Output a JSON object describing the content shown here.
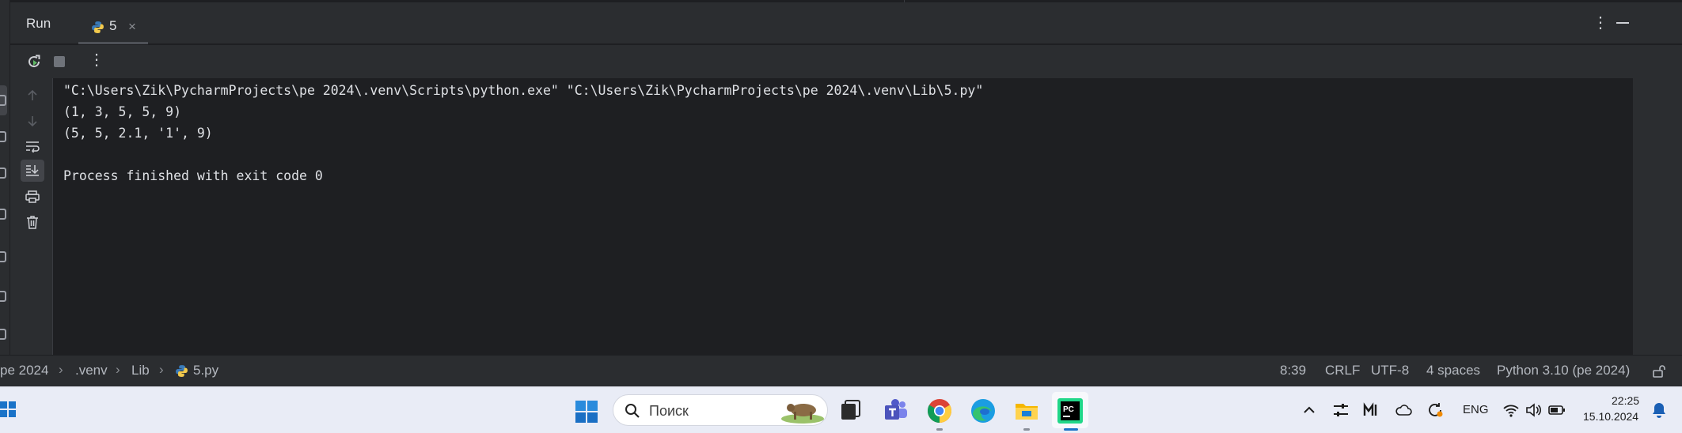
{
  "run_panel": {
    "title": "Run",
    "tab_label": "5",
    "tab_close": "×"
  },
  "console": {
    "lines": [
      "\"C:\\Users\\Zik\\PycharmProjects\\pe 2024\\.venv\\Scripts\\python.exe\" \"C:\\Users\\Zik\\PycharmProjects\\pe 2024\\.venv\\Lib\\5.py\"",
      "(1, 3, 5, 5, 9)",
      "(5, 5, 2.1, '1', 9)",
      "",
      "Process finished with exit code 0"
    ]
  },
  "breadcrumbs": [
    "pe 2024",
    ".venv",
    "Lib",
    "5.py"
  ],
  "status": {
    "position": "8:39",
    "line_separator": "CRLF",
    "encoding": "UTF-8",
    "indent": "4 spaces",
    "interpreter": "Python 3.10 (pe 2024)"
  },
  "taskbar": {
    "search_placeholder": "Поиск",
    "language": "ENG",
    "time": "22:25",
    "date": "15.10.2024"
  },
  "colors": {
    "panel_bg": "#2b2d30",
    "console_bg": "#1e1f22",
    "text": "#dfe1e5",
    "taskbar_bg": "#e9ecf6",
    "pycharm_accent": "#21d789"
  }
}
